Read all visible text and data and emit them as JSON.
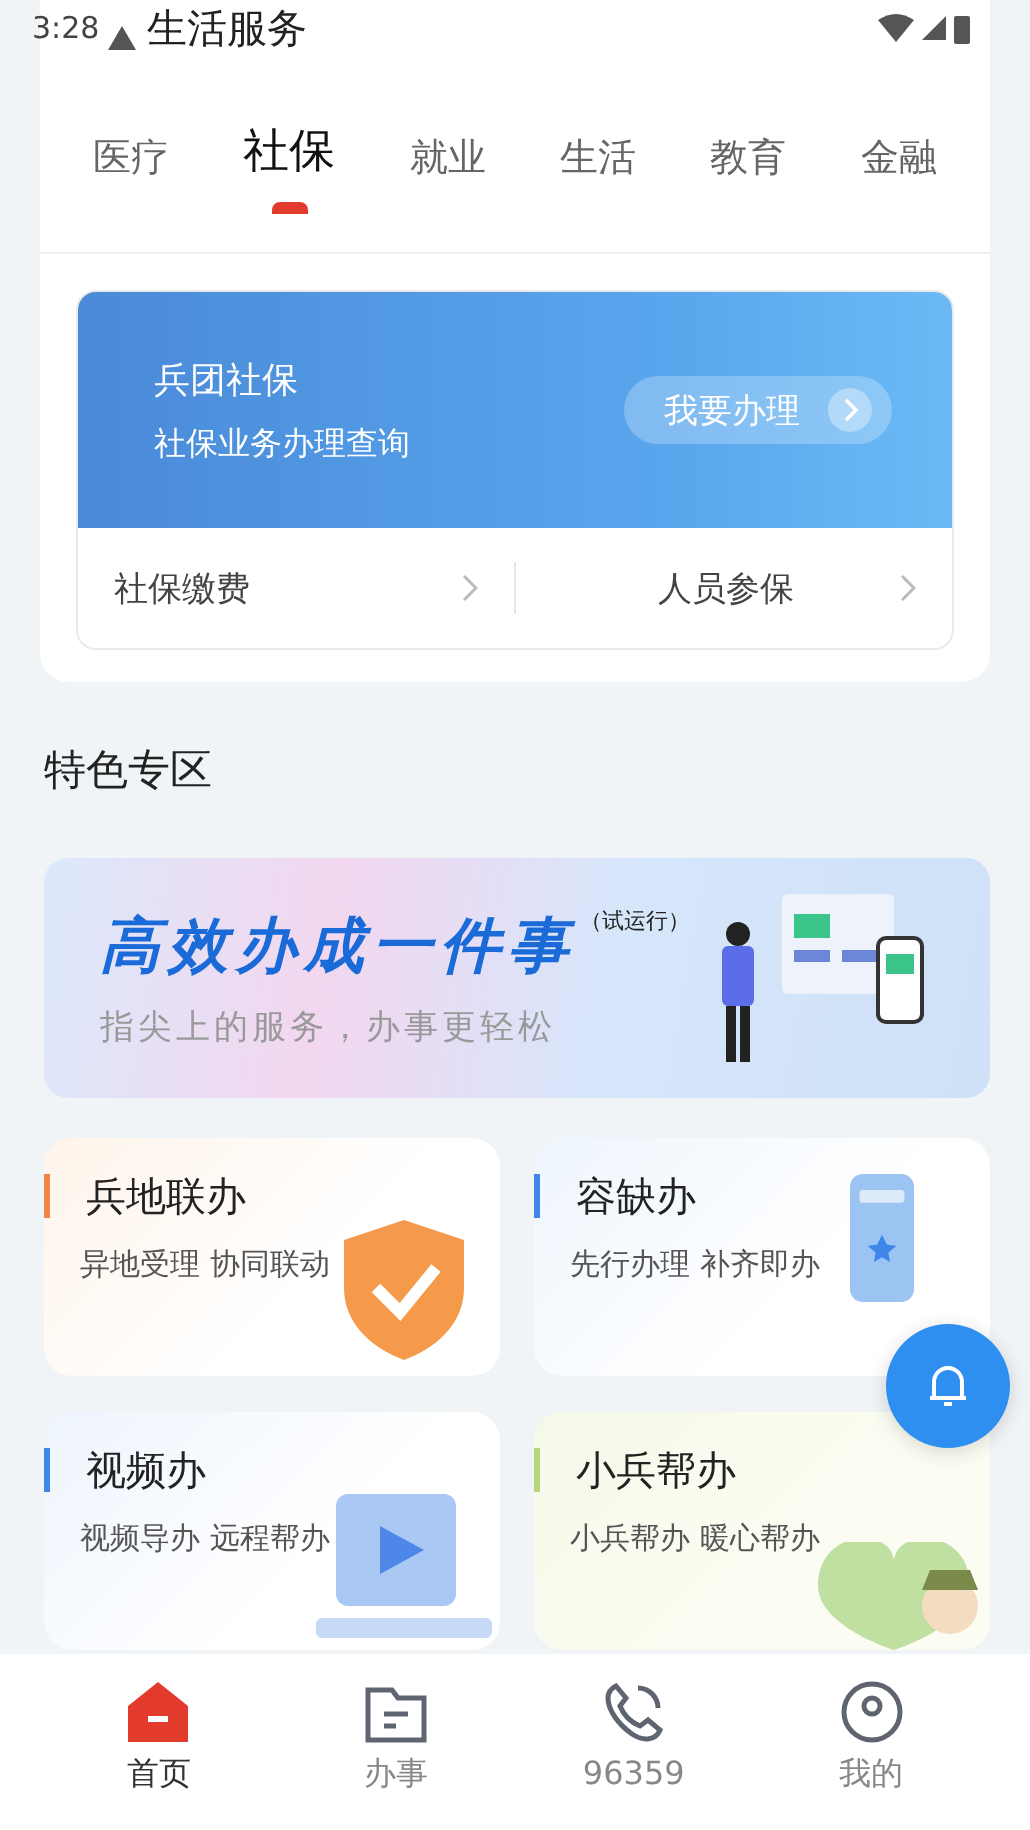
{
  "status_bar": {
    "time": "3:28"
  },
  "page_title": "生活服务",
  "tabs": [
    {
      "label": "医疗",
      "selected": false
    },
    {
      "label": "社保",
      "selected": true
    },
    {
      "label": "就业",
      "selected": false
    },
    {
      "label": "生活",
      "selected": false
    },
    {
      "label": "教育",
      "selected": false
    },
    {
      "label": "金融",
      "selected": false
    }
  ],
  "service_banner": {
    "title": "兵团社保",
    "subtitle": "社保业务办理查询",
    "button": "我要办理"
  },
  "service_links": [
    "社保缴费",
    "人员参保"
  ],
  "section_title": "特色专区",
  "promo_banner": {
    "title": "高效办成一件事",
    "tag": "（试运行）",
    "subtitle": "指尖上的服务，办事更轻松"
  },
  "feature_cards": [
    {
      "title": "兵地联办",
      "subtitle": "异地受理 协同联动",
      "color": "#f0834a",
      "kind": "shield"
    },
    {
      "title": "容缺办",
      "subtitle": "先行办理 补齐即办",
      "color": "#3f86ea",
      "kind": "phone"
    },
    {
      "title": "视频办",
      "subtitle": "视频导办 远程帮办",
      "color": "#3f86ea",
      "kind": "video"
    },
    {
      "title": "小兵帮办",
      "subtitle": "小兵帮办 暖心帮办",
      "color": "#b9d77a",
      "kind": "mascot"
    }
  ],
  "bottom_nav": [
    {
      "label": "首页",
      "selected": true,
      "kind": "home"
    },
    {
      "label": "办事",
      "selected": false,
      "kind": "tasks"
    },
    {
      "label": "96359",
      "selected": false,
      "kind": "phone"
    },
    {
      "label": "我的",
      "selected": false,
      "kind": "user"
    }
  ]
}
